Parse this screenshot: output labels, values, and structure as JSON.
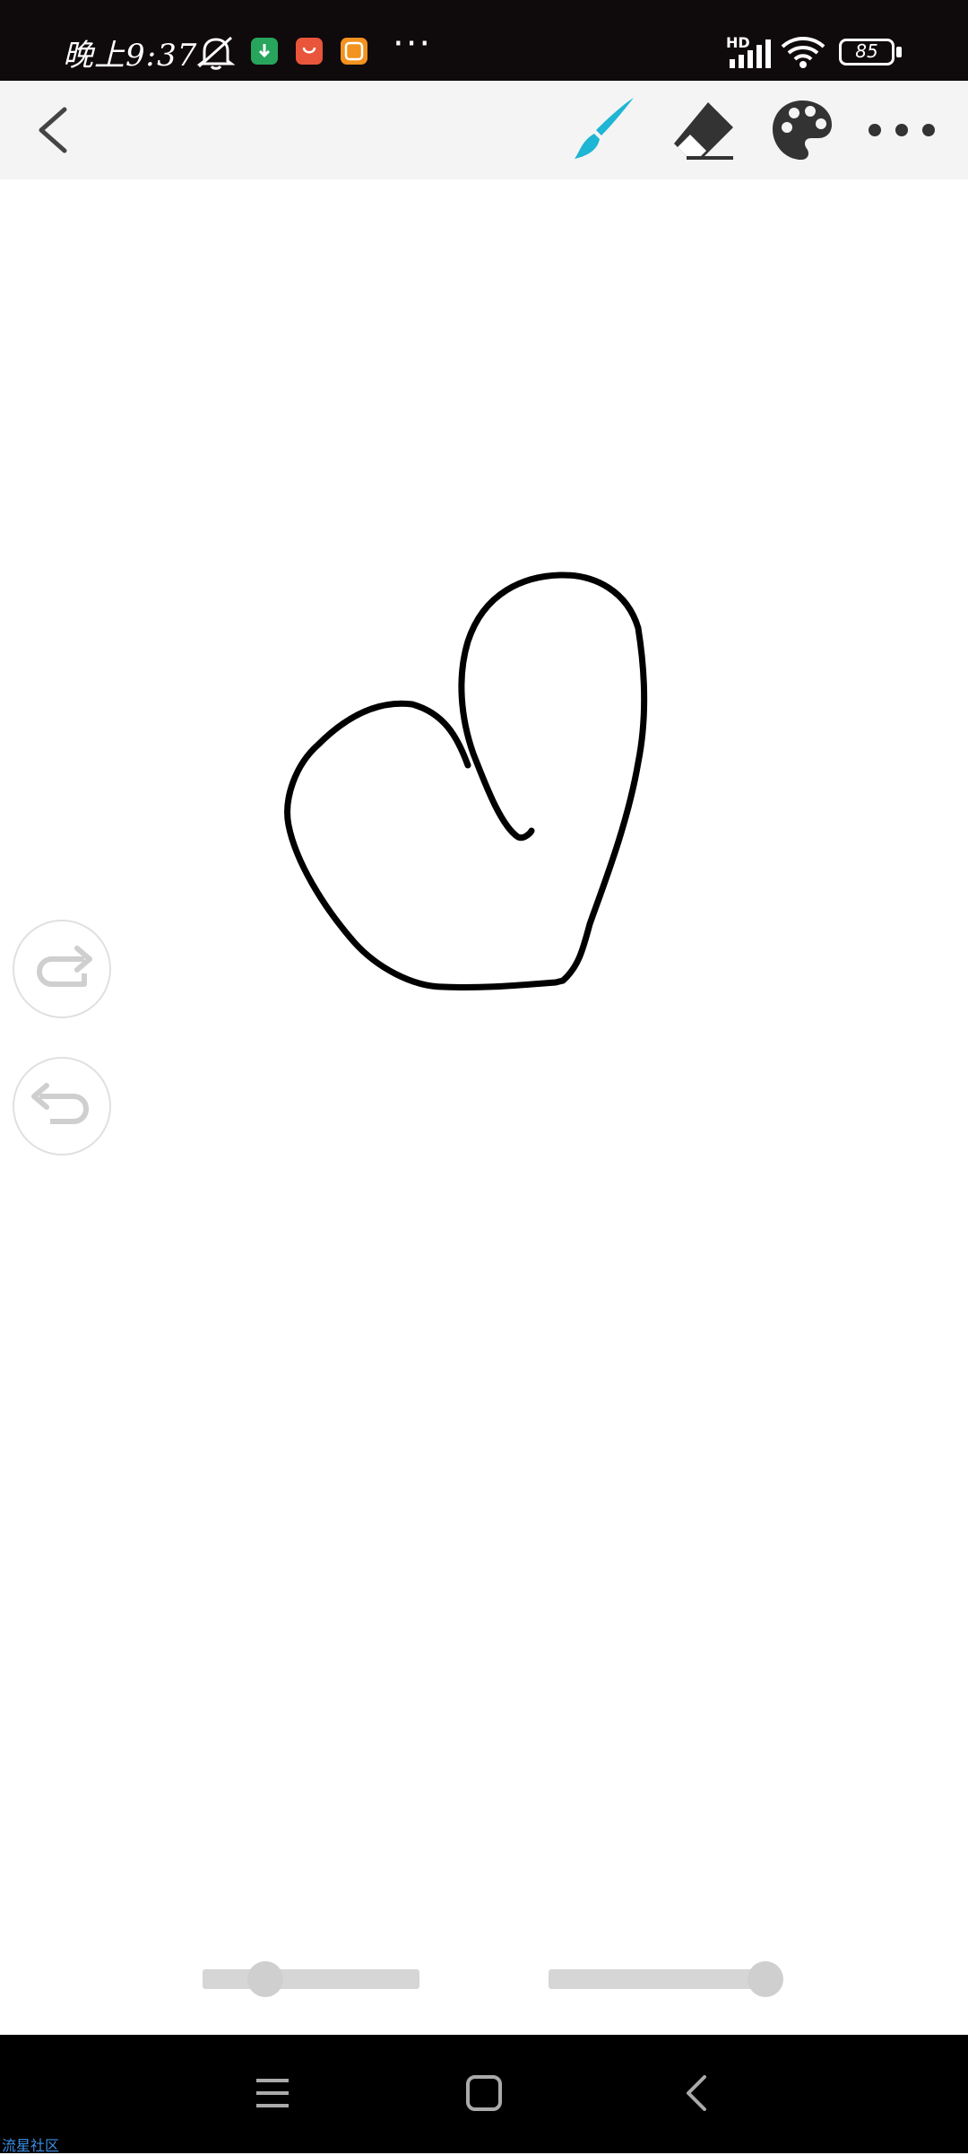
{
  "status_bar": {
    "time": "晚上9:37",
    "signal_label": "HD",
    "battery": "85",
    "more": "···"
  },
  "toolbar": {
    "back_icon": "chevron-left-icon",
    "brush_icon": "brush-icon",
    "eraser_icon": "eraser-icon",
    "palette_icon": "palette-icon",
    "more_icon": "more-horizontal-icon",
    "accent_color": "#1fb5d4"
  },
  "canvas": {
    "stroke_color": "#000000"
  },
  "side_buttons": {
    "redo_icon": "redo-icon",
    "undo_icon": "undo-icon"
  },
  "sliders": [
    {
      "name": "brush-size",
      "value": 0.28
    },
    {
      "name": "opacity",
      "value": 1.0
    }
  ],
  "nav_bar": {
    "menu_icon": "menu-icon",
    "home_icon": "home-icon",
    "back_icon": "back-icon"
  },
  "watermark": "流星社区"
}
